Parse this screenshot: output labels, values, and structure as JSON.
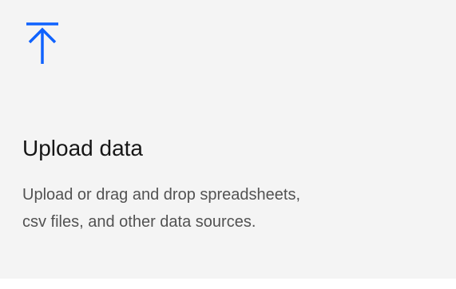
{
  "tile": {
    "icon": "upload-icon",
    "title": "Upload data",
    "description": "Upload or drag and drop spreadsheets, csv files, and other data sources."
  },
  "colors": {
    "tile_background": "#f4f4f4",
    "icon_accent": "#0f62fe",
    "title_text": "#161616",
    "description_text": "#525252",
    "page_background": "#ffffff"
  }
}
